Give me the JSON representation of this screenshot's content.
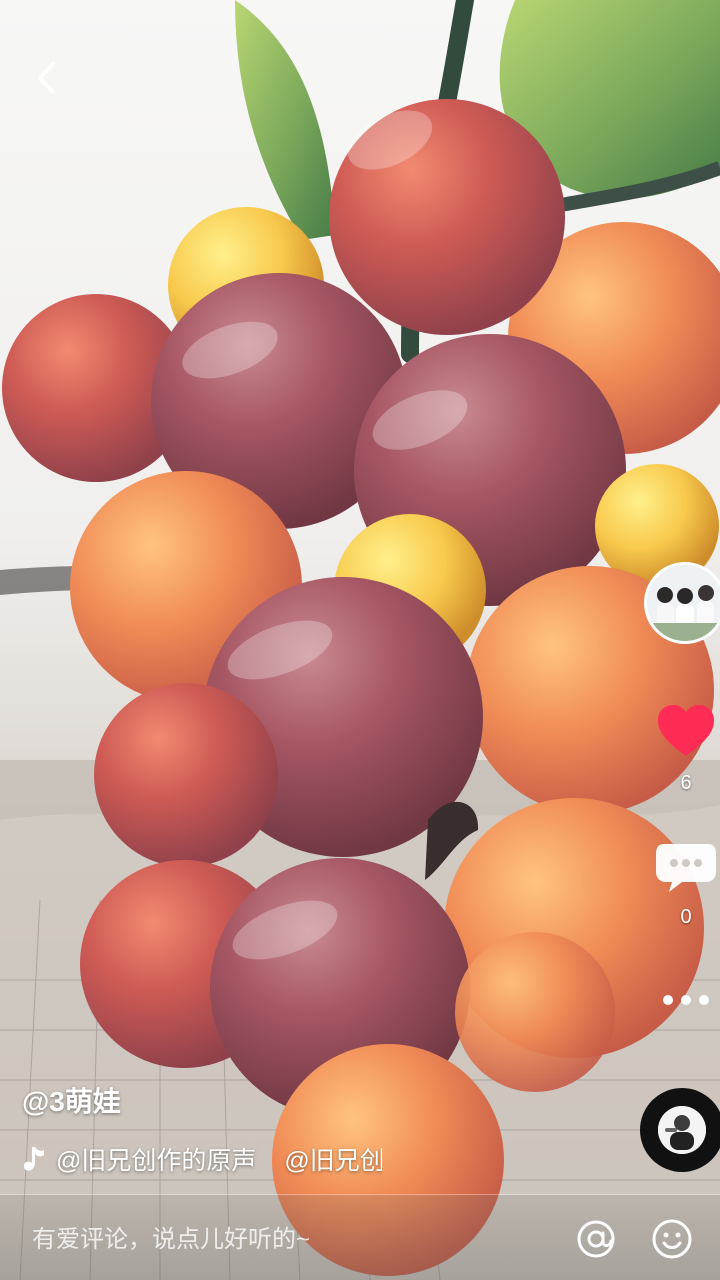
{
  "app": {
    "brand_color": "#fe2c55",
    "text_color": "#ffffff"
  },
  "video": {
    "subject": "grapes-icon"
  },
  "creator": {
    "username": "@3萌娃",
    "avatar_icon": "children-avatar-icon"
  },
  "actions": {
    "like_count": "6",
    "comment_count": "0",
    "more_icon": "more-dots-icon"
  },
  "music": {
    "title": "@旧兄创作的原声",
    "tag": "@旧兄创",
    "icon": "music-note-icon"
  },
  "comment_bar": {
    "placeholder": "有爱评论，说点儿好听的~",
    "at_icon": "at-icon",
    "emoji_icon": "emoji-icon"
  }
}
